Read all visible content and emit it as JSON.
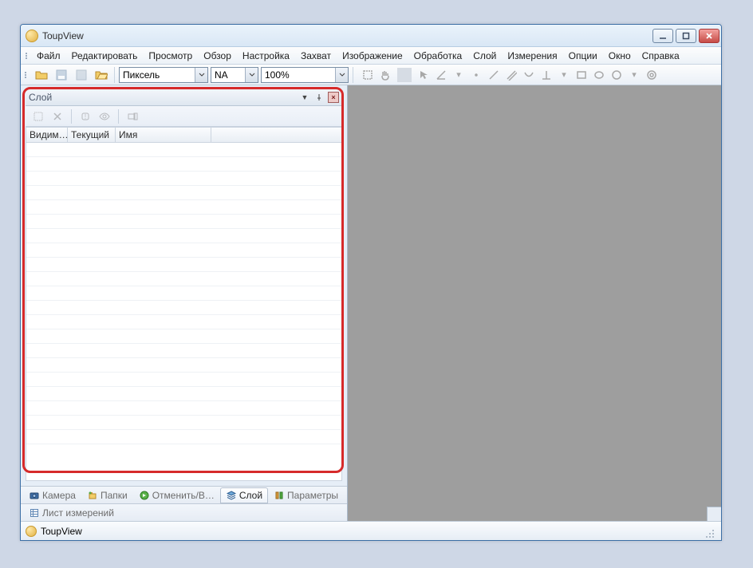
{
  "window": {
    "title": "ToupView"
  },
  "menu": {
    "file": "Файл",
    "edit": "Редактировать",
    "view": "Просмотр",
    "browse": "Обзор",
    "setup": "Настройка",
    "capture": "Захват",
    "image": "Изображение",
    "process": "Обработка",
    "layer": "Слой",
    "measure": "Измерения",
    "options": "Опции",
    "windowm": "Окно",
    "help": "Справка"
  },
  "toolbar": {
    "unit_value": "Пиксель",
    "na_value": "NA",
    "zoom_value": "100%"
  },
  "panel": {
    "title": "Слой",
    "columns": {
      "visible": "Видим…",
      "current": "Текущий",
      "name": "Имя"
    }
  },
  "tabs": {
    "camera": "Камера",
    "folders": "Папки",
    "undo": "Отменить/В…",
    "layer": "Слой",
    "params": "Параметры",
    "measure_sheet": "Лист измерений"
  },
  "status": {
    "app": "ToupView"
  }
}
